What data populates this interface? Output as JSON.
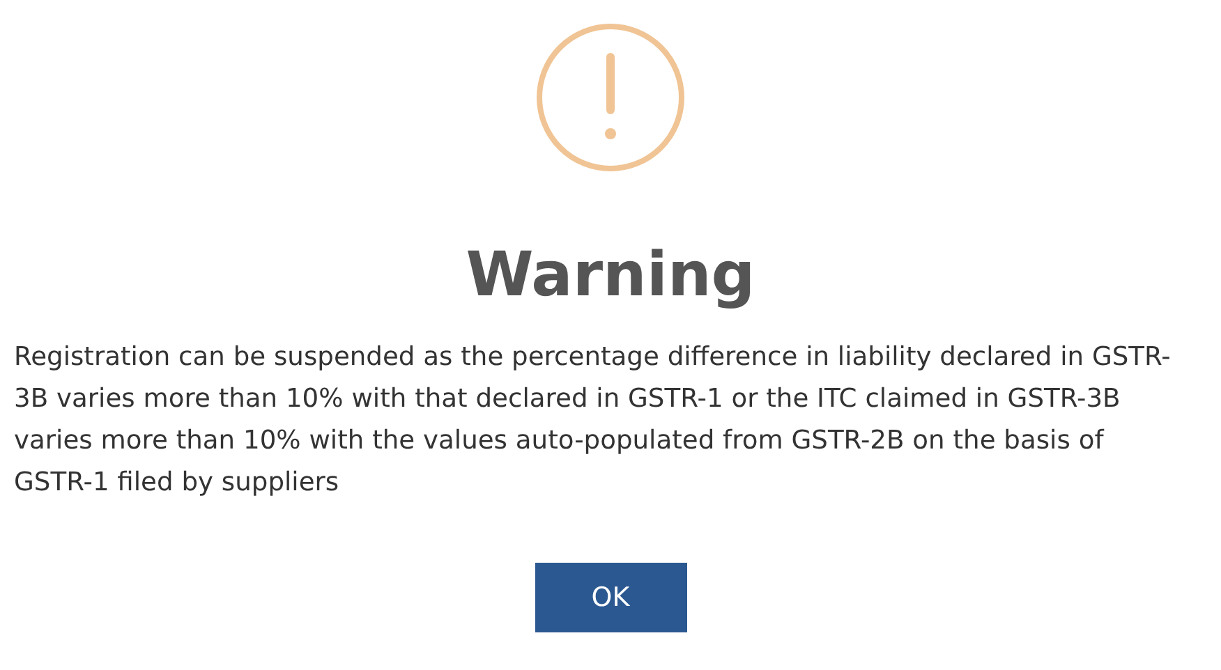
{
  "dialog": {
    "title": "Warning",
    "message": "Registration can be suspended as the percentage difference in liability declared in GSTR-3B varies more than 10% with that declared in GSTR-1 or the ITC claimed in GSTR-3B varies more than 10% with the values auto-populated from GSTR-2B on the basis of GSTR-1 filed by suppliers",
    "buttons": [
      "OK"
    ]
  }
}
